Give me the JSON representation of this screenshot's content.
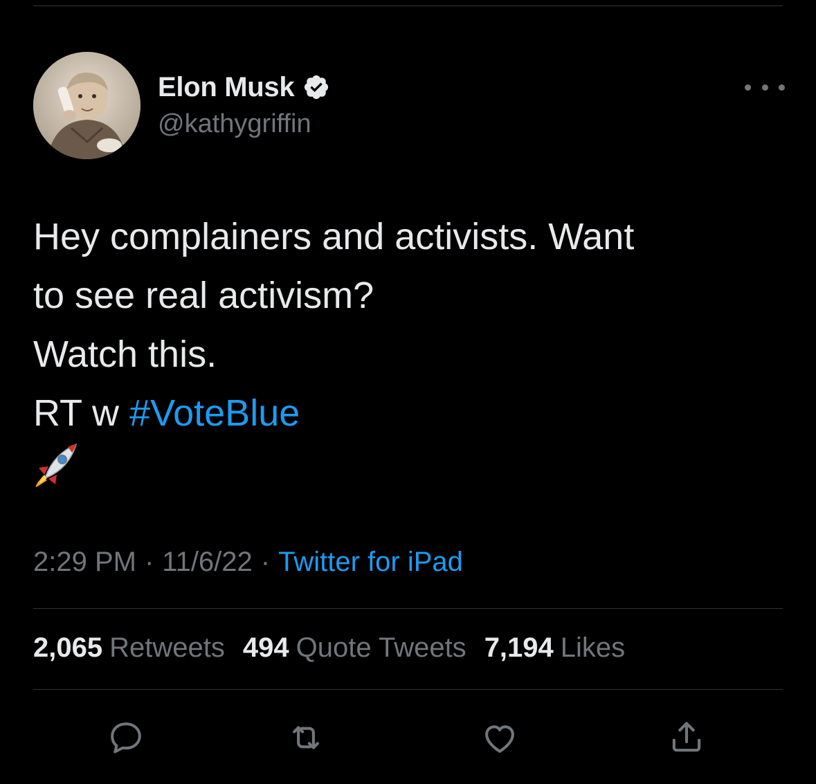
{
  "author": {
    "display_name": "Elon Musk",
    "handle": "@kathygriffin",
    "verified": true,
    "avatar_icon": "avatar-photo"
  },
  "tweet": {
    "lines": [
      "Hey complainers and activists. Want",
      "to see real activism?",
      "Watch this."
    ],
    "rt_prefix": "RT w",
    "hashtag": "#VoteBlue",
    "emoji": "rocket-icon"
  },
  "meta": {
    "time": "2:29 PM",
    "separator": "·",
    "date": "11/6/22",
    "source": "Twitter for iPad"
  },
  "stats": {
    "retweets_count": "2,065",
    "retweets_label": "Retweets",
    "quotes_count": "494",
    "quotes_label": "Quote Tweets",
    "likes_count": "7,194",
    "likes_label": "Likes"
  },
  "actions": [
    "reply-icon",
    "retweet-icon",
    "like-icon",
    "share-icon"
  ],
  "colors": {
    "background": "#000000",
    "text_primary": "#e7e9ea",
    "text_secondary": "#71767b",
    "accent": "#1d9bf0",
    "divider": "#2f3336"
  }
}
